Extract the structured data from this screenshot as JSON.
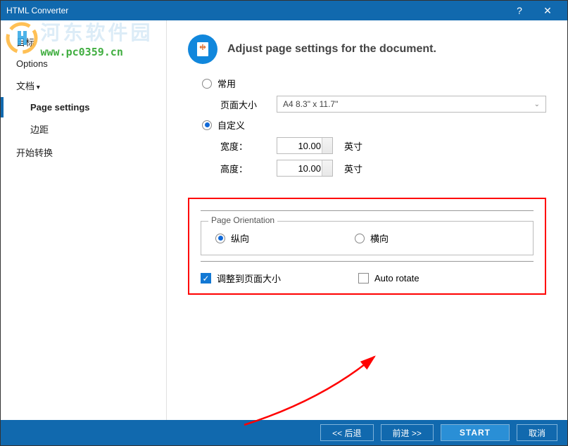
{
  "window": {
    "title": "HTML Converter"
  },
  "watermark": {
    "text1": "河东软件园",
    "text2": "www.pc0359.cn"
  },
  "sidebar": {
    "items": [
      {
        "label": "目标"
      },
      {
        "label": "Options"
      },
      {
        "label": "文档"
      },
      {
        "label": "Page settings"
      },
      {
        "label": "边距"
      },
      {
        "label": "开始转换"
      }
    ]
  },
  "header": {
    "title": "Adjust page settings for the document."
  },
  "page": {
    "common_label": "常用",
    "page_size_label": "页面大小",
    "page_size_value": "A4 8.3\" x 11.7\"",
    "custom_label": "自定义",
    "width_label": "宽度：",
    "width_value": "10.00",
    "height_label": "高度：",
    "height_value": "10.00",
    "unit": "英寸"
  },
  "orientation": {
    "legend": "Page Orientation",
    "portrait": "纵向",
    "landscape": "横向"
  },
  "options": {
    "fit_label": "调整到页面大小",
    "auto_rotate_label": "Auto rotate"
  },
  "footer": {
    "back": "<<  后退",
    "next": "前进  >>",
    "start": "START",
    "cancel": "取消"
  }
}
